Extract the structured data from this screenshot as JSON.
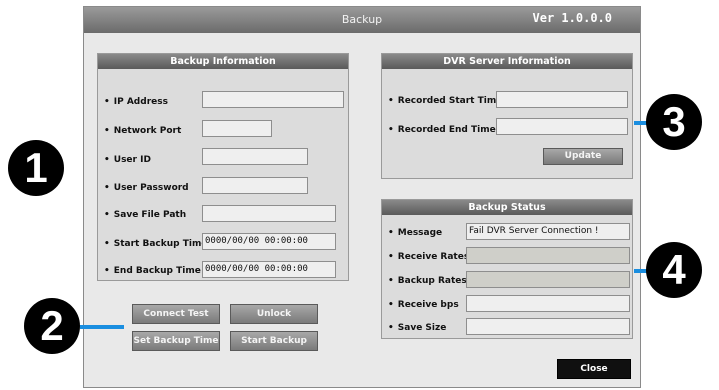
{
  "window": {
    "title": "Backup",
    "version": "Ver 1.0.0.0"
  },
  "backup_info": {
    "heading": "Backup Information",
    "fields": [
      {
        "label": "IP Address",
        "value": ""
      },
      {
        "label": "Network Port",
        "value": ""
      },
      {
        "label": "User ID",
        "value": ""
      },
      {
        "label": "User Password",
        "value": ""
      },
      {
        "label": "Save File Path",
        "value": ""
      },
      {
        "label": "Start Backup Time",
        "value": "0000/00/00 00:00:00"
      },
      {
        "label": "End Backup Time",
        "value": "0000/00/00 00:00:00"
      }
    ]
  },
  "buttons": {
    "connect_test": "Connect Test",
    "unlock": "Unlock",
    "set_backup_time": "Set Backup Time",
    "start_backup": "Start Backup",
    "update": "Update",
    "close": "Close"
  },
  "dvr_info": {
    "heading": "DVR Server Information",
    "fields": [
      {
        "label": "Recorded Start Time",
        "value": ""
      },
      {
        "label": "Recorded End Time",
        "value": ""
      }
    ]
  },
  "backup_status": {
    "heading": "Backup Status",
    "fields": [
      {
        "label": "Message",
        "value": "Fail DVR Server Connection !"
      },
      {
        "label": "Receive Rates",
        "value": ""
      },
      {
        "label": "Backup Rates",
        "value": ""
      },
      {
        "label": "Receive bps",
        "value": ""
      },
      {
        "label": "Save Size",
        "value": ""
      }
    ]
  },
  "callouts": [
    "1",
    "2",
    "3",
    "4"
  ],
  "colors": {
    "highlight": "#1a8ee0",
    "callout_bg": "#000000"
  }
}
